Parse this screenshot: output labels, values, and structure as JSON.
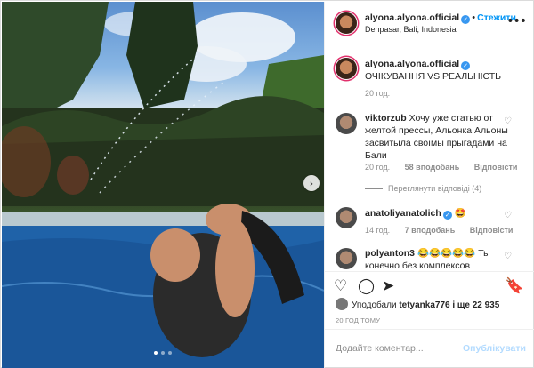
{
  "post": {
    "username": "alyona.alyona.official",
    "follow_label": "Стежити",
    "location": "Denpasar, Bali, Indonesia",
    "caption": "ОЧІКУВАННЯ VS РЕАЛЬНІСТЬ",
    "caption_time": "20 год.",
    "more_label": "•••"
  },
  "comments": [
    {
      "username": "viktorzub",
      "text": "Хочу уже статью от желтой прессы, Альонка Альоны засвитыла своїмы прыгадами на Бали",
      "time": "20 год.",
      "likes": "58 вподобань",
      "reply": "Відповісти",
      "view_replies": "Переглянути відповіді (4)"
    },
    {
      "username": "anatoliyanatolich",
      "text": "🤩",
      "time": "14 год.",
      "likes": "7 вподобань",
      "reply": "Відповісти"
    },
    {
      "username": "polyanton3",
      "text": "😂😂😂😂😂 Ты конечно без комплексов"
    }
  ],
  "likes_summary": {
    "prefix": "Уподобали",
    "user": "tetyanka776",
    "suffix": "і ще 22 935"
  },
  "timestamp": "20 ГОД ТОМУ",
  "add_comment": {
    "placeholder": "Додайте коментар...",
    "publish_label": "Опублікувати"
  },
  "icons": {
    "heart": "heart-icon",
    "comment": "comment-icon",
    "share": "share-icon",
    "save": "bookmark-icon",
    "next": "chevron-right-icon",
    "verified": "verified-badge-icon"
  },
  "carousel": {
    "slides": 3,
    "active_index": 0
  },
  "colors": {
    "link": "#0095f6",
    "verified": "#3897f0",
    "publish_disabled": "#b3dbff",
    "meta": "#8e8e8e"
  }
}
